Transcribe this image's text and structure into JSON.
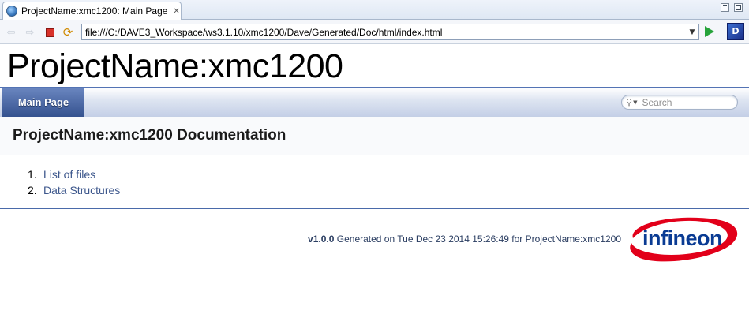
{
  "editor_tab": {
    "title": "ProjectName:xmc1200: Main Page",
    "close_glyph": "✕",
    "icon": "globe-icon"
  },
  "window_controls": {
    "minimize_icon": "minimize-icon",
    "maximize_icon": "maximize-icon"
  },
  "toolbar": {
    "back_icon": "back-arrow-icon",
    "forward_icon": "forward-arrow-icon",
    "stop_icon": "stop-icon",
    "refresh_icon": "refresh-icon",
    "url": "file:///C:/DAVE3_Workspace/ws3.1.10/xmc1200/Dave/Generated/Doc/html/index.html",
    "dropdown_icon": "chevron-down-icon",
    "go_icon": "go-play-icon",
    "app_icon": "dave-logo-icon"
  },
  "page": {
    "project_title": "ProjectName:xmc1200",
    "nav": {
      "active_tab": "Main Page"
    },
    "search": {
      "placeholder": "Search",
      "icon": "search-icon"
    },
    "header_title": "ProjectName:xmc1200 Documentation",
    "contents": [
      {
        "number": "1.",
        "label": "List of files"
      },
      {
        "number": "2.",
        "label": "Data Structures"
      }
    ],
    "footer": {
      "version": "v1.0.0",
      "generated_text": "Generated on Tue Dec 23 2014 15:26:49 for ProjectName:xmc1200"
    },
    "logo": {
      "text": "infineon"
    }
  },
  "colors": {
    "nav_tab": "#35528f",
    "link": "#3d578c",
    "logo_red": "#e2001a",
    "logo_blue": "#0a3b93",
    "go_green": "#26a33a",
    "stop_red": "#d8322a"
  }
}
